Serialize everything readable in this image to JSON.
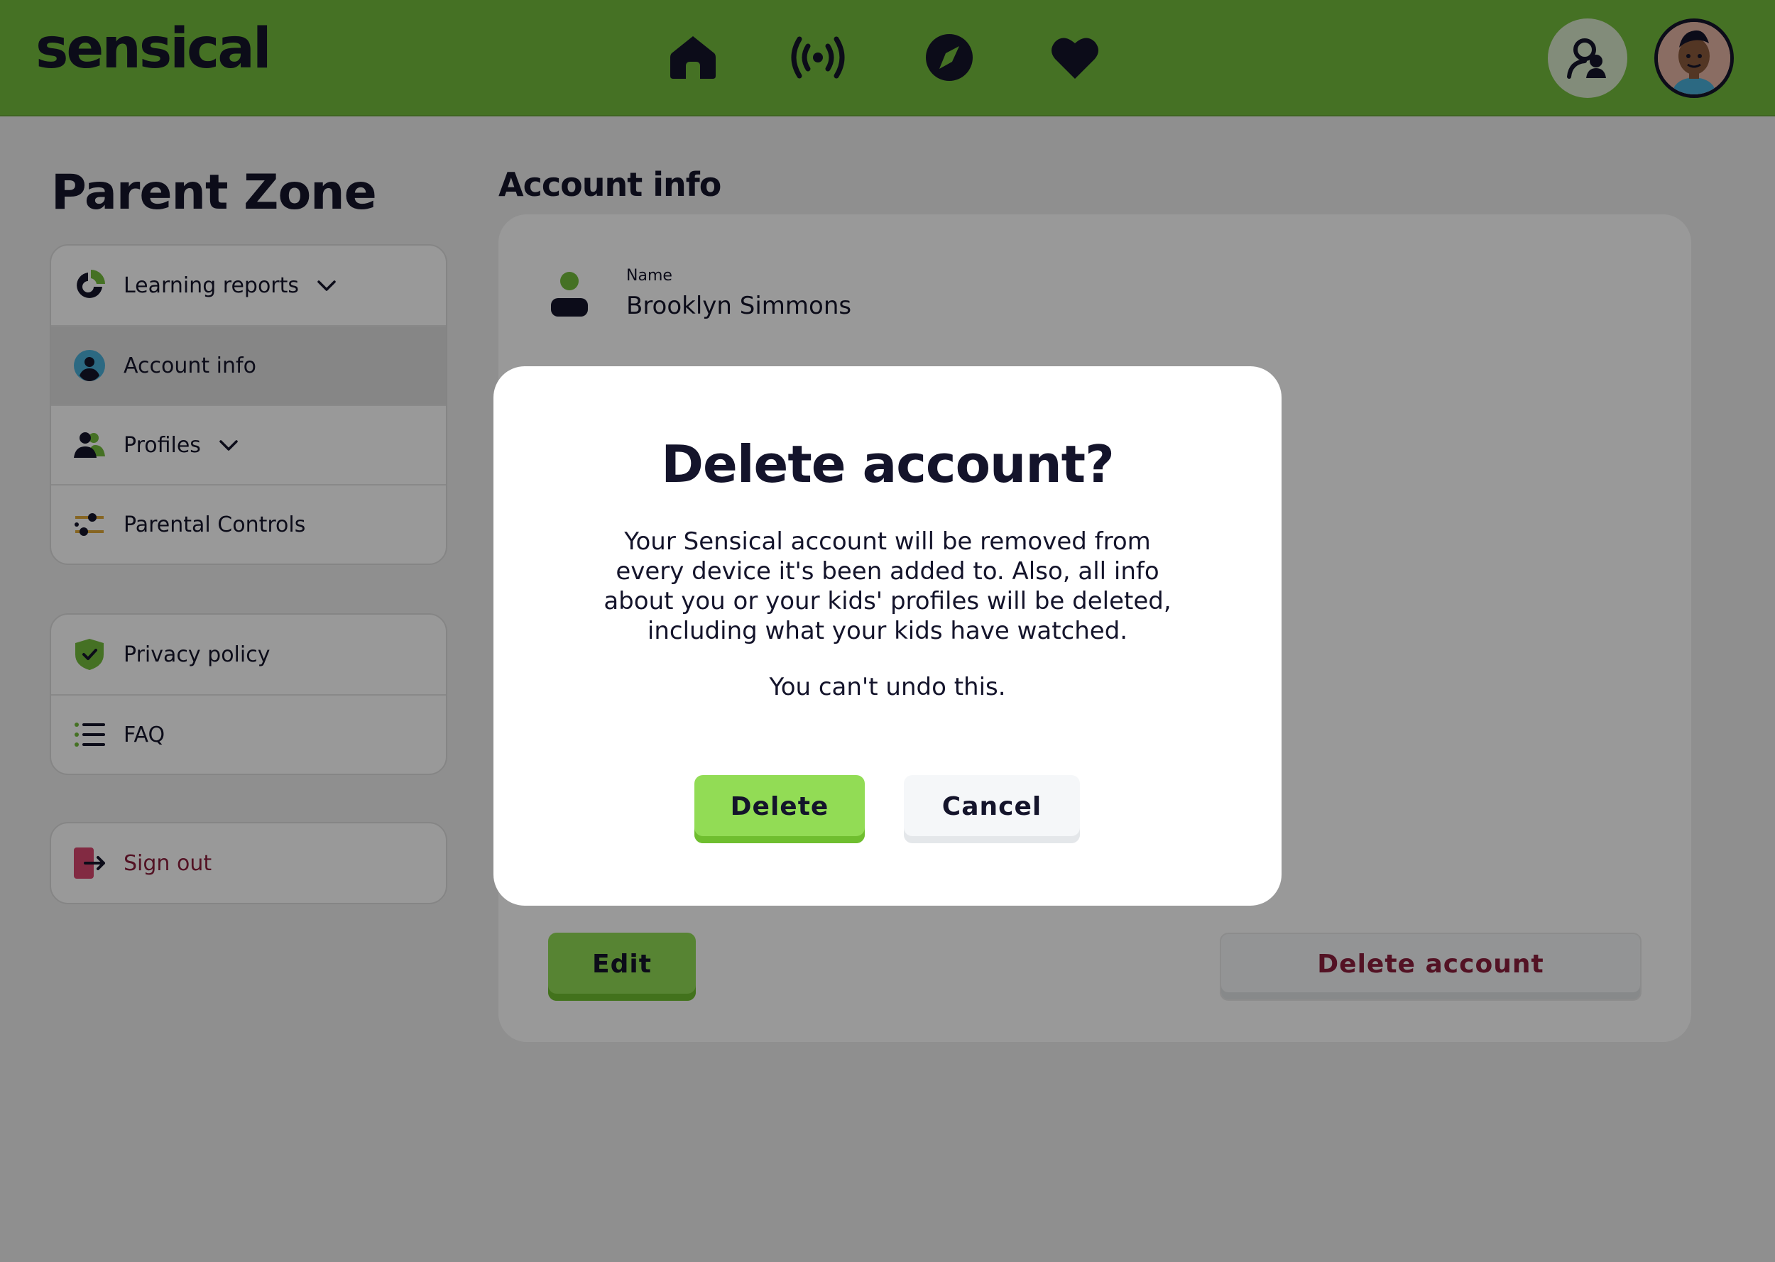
{
  "app": {
    "logo": "sensical"
  },
  "header": {
    "nav": [
      {
        "icon": "home-icon"
      },
      {
        "icon": "live-broadcast-icon"
      },
      {
        "icon": "explore-compass-icon"
      },
      {
        "icon": "favorites-heart-icon"
      }
    ],
    "actions": [
      {
        "icon": "parent-profile-icon"
      },
      {
        "icon": "user-avatar"
      }
    ]
  },
  "sidebar": {
    "title": "Parent Zone",
    "groups": [
      [
        {
          "label": "Learning reports",
          "icon": "pie-chart-icon",
          "expandable": true
        },
        {
          "label": "Account info",
          "icon": "account-icon",
          "active": true
        },
        {
          "label": "Profiles",
          "icon": "profiles-icon",
          "expandable": true
        },
        {
          "label": "Parental Controls",
          "icon": "sliders-icon"
        }
      ],
      [
        {
          "label": "Privacy policy",
          "icon": "shield-check-icon"
        },
        {
          "label": "FAQ",
          "icon": "list-icon"
        }
      ],
      [
        {
          "label": "Sign out",
          "icon": "sign-out-icon"
        }
      ]
    ]
  },
  "main": {
    "title": "Account info",
    "name_label": "Name",
    "name_value": "Brooklyn Simmons",
    "edit_label": "Edit",
    "delete_account_label": "Delete account"
  },
  "modal": {
    "title": "Delete account?",
    "body": "Your Sensical account will be removed from every device it's been added to. Also, all info about you or your kids' profiles will be deleted, including what your kids have watched.",
    "warning": "You can't undo this.",
    "delete_label": "Delete",
    "cancel_label": "Cancel"
  },
  "colors": {
    "brand_green": "#74bc3d",
    "button_green": "#92dc55",
    "danger": "#8a1f3c",
    "ink": "#14142b"
  }
}
